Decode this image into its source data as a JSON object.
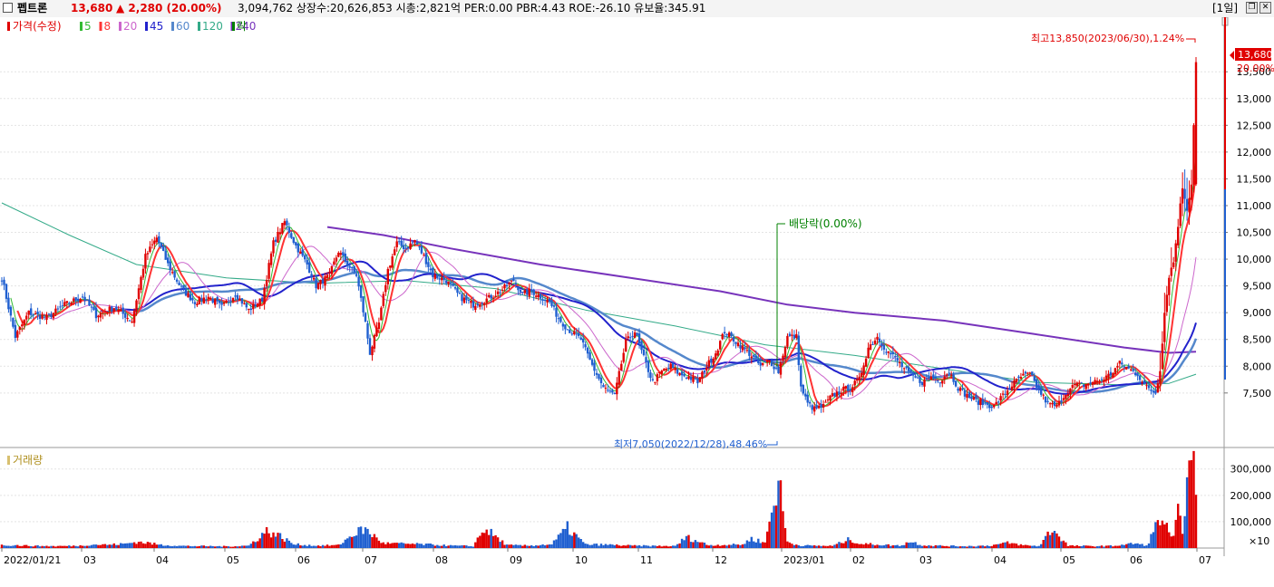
{
  "header": {
    "stock_name": "펩트론",
    "price": "13,680",
    "change": "▲ 2,280 (20.00%)",
    "stats": "3,094,762  상장수:20,626,853 시총:2,821억  PER:0.00  PBR:4.43  ROE:-26.10  유보율:345.91",
    "period": "[1일]"
  },
  "legend": {
    "price_label": "가격(수정)",
    "ma_periods": [
      "5",
      "8",
      "20",
      "45",
      "60",
      "120",
      "240"
    ],
    "ma_colors": [
      "#33bb33",
      "#ff3333",
      "#cc66cc",
      "#2222cc",
      "#5588cc",
      "#33aa88",
      "#7733bb"
    ],
    "drop_label": "락",
    "volume_label": "거래량"
  },
  "annotations": {
    "high": "최고13,850(2023/06/30),1.24%",
    "low": "최저7,050(2022/12/28),48.46%",
    "dividend": "배당락(0.00%)",
    "current_price_tag": "13,680",
    "current_pct_tag": "20.00%",
    "volume_unit": "×10"
  },
  "colors": {
    "up": "#e00000",
    "down": "#1f5fd0",
    "dividend": "#008000"
  },
  "chart_data": {
    "type": "candlestick",
    "price_axis": {
      "ticks": [
        7500,
        8000,
        8500,
        9000,
        9500,
        10000,
        10500,
        11000,
        11500,
        12000,
        12500,
        13000,
        13500
      ],
      "range": [
        6600,
        14350
      ]
    },
    "volume_axis": {
      "ticks": [
        100000,
        200000,
        300000
      ],
      "range": [
        0,
        330000
      ]
    },
    "x_labels": [
      "2022/01/21",
      "03",
      "04",
      "05",
      "06",
      "07",
      "08",
      "09",
      "10",
      "11",
      "12",
      "2023/01",
      "02",
      "03",
      "04",
      "05",
      "06",
      "07"
    ],
    "price_path": [
      [
        0,
        9650
      ],
      [
        6,
        8550
      ],
      [
        12,
        9000
      ],
      [
        20,
        8900
      ],
      [
        28,
        9150
      ],
      [
        36,
        9300
      ],
      [
        42,
        8950
      ],
      [
        50,
        9100
      ],
      [
        58,
        8850
      ],
      [
        64,
        10050
      ],
      [
        69,
        10400
      ],
      [
        74,
        9900
      ],
      [
        80,
        9450
      ],
      [
        86,
        9200
      ],
      [
        92,
        9300
      ],
      [
        98,
        9100
      ],
      [
        104,
        9350
      ],
      [
        110,
        9050
      ],
      [
        116,
        9250
      ],
      [
        121,
        10300
      ],
      [
        126,
        10700
      ],
      [
        131,
        10250
      ],
      [
        136,
        9900
      ],
      [
        140,
        9500
      ],
      [
        146,
        9700
      ],
      [
        150,
        10150
      ],
      [
        154,
        9900
      ],
      [
        158,
        9700
      ],
      [
        162,
        8800
      ],
      [
        164,
        8250
      ],
      [
        168,
        8800
      ],
      [
        172,
        9800
      ],
      [
        176,
        10300
      ],
      [
        180,
        10200
      ],
      [
        184,
        10350
      ],
      [
        188,
        10050
      ],
      [
        192,
        9700
      ],
      [
        198,
        9600
      ],
      [
        204,
        9300
      ],
      [
        210,
        9150
      ],
      [
        216,
        9250
      ],
      [
        222,
        9400
      ],
      [
        228,
        9600
      ],
      [
        232,
        9350
      ],
      [
        236,
        9400
      ],
      [
        240,
        9300
      ],
      [
        244,
        9200
      ],
      [
        248,
        8900
      ],
      [
        252,
        8700
      ],
      [
        258,
        8500
      ],
      [
        262,
        8100
      ],
      [
        268,
        7600
      ],
      [
        273,
        7450
      ],
      [
        278,
        8450
      ],
      [
        282,
        8650
      ],
      [
        286,
        8150
      ],
      [
        290,
        7700
      ],
      [
        294,
        7900
      ],
      [
        298,
        8000
      ],
      [
        302,
        7850
      ],
      [
        306,
        7800
      ],
      [
        310,
        7700
      ],
      [
        314,
        8000
      ],
      [
        318,
        8250
      ],
      [
        322,
        8650
      ],
      [
        326,
        8500
      ],
      [
        330,
        8350
      ],
      [
        334,
        8200
      ],
      [
        338,
        8000
      ],
      [
        342,
        8100
      ],
      [
        346,
        7900
      ],
      [
        350,
        8550
      ],
      [
        354,
        8550
      ],
      [
        356,
        7600
      ],
      [
        359,
        7300
      ],
      [
        362,
        7200
      ],
      [
        366,
        7250
      ],
      [
        370,
        7450
      ],
      [
        374,
        7550
      ],
      [
        378,
        7600
      ],
      [
        382,
        7750
      ],
      [
        386,
        8350
      ],
      [
        390,
        8550
      ],
      [
        394,
        8300
      ],
      [
        398,
        8150
      ],
      [
        402,
        7950
      ],
      [
        406,
        7800
      ],
      [
        410,
        7700
      ],
      [
        414,
        7800
      ],
      [
        418,
        7750
      ],
      [
        422,
        7900
      ],
      [
        426,
        7600
      ],
      [
        430,
        7450
      ],
      [
        434,
        7350
      ],
      [
        438,
        7300
      ],
      [
        442,
        7250
      ],
      [
        446,
        7450
      ],
      [
        450,
        7650
      ],
      [
        454,
        7800
      ],
      [
        458,
        7850
      ],
      [
        462,
        7550
      ],
      [
        466,
        7300
      ],
      [
        470,
        7250
      ],
      [
        474,
        7500
      ],
      [
        478,
        7650
      ],
      [
        482,
        7650
      ],
      [
        486,
        7700
      ],
      [
        490,
        7750
      ],
      [
        494,
        7850
      ],
      [
        498,
        8050
      ],
      [
        502,
        7950
      ],
      [
        506,
        7850
      ],
      [
        510,
        7600
      ],
      [
        514,
        7500
      ],
      [
        516,
        7950
      ],
      [
        518,
        9000
      ],
      [
        520,
        9700
      ],
      [
        522,
        9950
      ],
      [
        524,
        10650
      ],
      [
        526,
        11350
      ],
      [
        528,
        10950
      ],
      [
        530,
        11400
      ],
      [
        532,
        13680
      ]
    ],
    "ma240_path": [
      [
        145,
        10600
      ],
      [
        170,
        10450
      ],
      [
        200,
        10200
      ],
      [
        240,
        9900
      ],
      [
        280,
        9650
      ],
      [
        320,
        9400
      ],
      [
        350,
        9150
      ],
      [
        380,
        9000
      ],
      [
        420,
        8850
      ],
      [
        460,
        8600
      ],
      [
        500,
        8350
      ],
      [
        520,
        8250
      ],
      [
        532,
        8270
      ]
    ],
    "ma120_path": [
      [
        0,
        11050
      ],
      [
        30,
        10450
      ],
      [
        60,
        9900
      ],
      [
        100,
        9650
      ],
      [
        140,
        9550
      ],
      [
        180,
        9600
      ],
      [
        220,
        9450
      ],
      [
        260,
        9050
      ],
      [
        300,
        8750
      ],
      [
        340,
        8400
      ],
      [
        380,
        8200
      ],
      [
        420,
        7950
      ],
      [
        460,
        7700
      ],
      [
        500,
        7650
      ],
      [
        520,
        7680
      ],
      [
        532,
        7850
      ]
    ],
    "volumes": [
      [
        5,
        12000
      ],
      [
        15,
        9000
      ],
      [
        25,
        8000
      ],
      [
        35,
        10000
      ],
      [
        40,
        15000
      ],
      [
        48,
        14000
      ],
      [
        55,
        18000
      ],
      [
        60,
        26000
      ],
      [
        65,
        22000
      ],
      [
        70,
        14000
      ],
      [
        80,
        9000
      ],
      [
        90,
        8000
      ],
      [
        100,
        7000
      ],
      [
        110,
        10000
      ],
      [
        118,
        72000
      ],
      [
        124,
        50000
      ],
      [
        130,
        16000
      ],
      [
        140,
        10000
      ],
      [
        150,
        12000
      ],
      [
        158,
        68000
      ],
      [
        162,
        78000
      ],
      [
        170,
        20000
      ],
      [
        180,
        18000
      ],
      [
        190,
        15000
      ],
      [
        200,
        10000
      ],
      [
        210,
        8000
      ],
      [
        215,
        83000
      ],
      [
        225,
        12000
      ],
      [
        235,
        10000
      ],
      [
        245,
        16000
      ],
      [
        252,
        85000
      ],
      [
        260,
        15000
      ],
      [
        270,
        14000
      ],
      [
        280,
        10000
      ],
      [
        290,
        9000
      ],
      [
        300,
        8000
      ],
      [
        305,
        46000
      ],
      [
        315,
        12000
      ],
      [
        330,
        15000
      ],
      [
        334,
        40000
      ],
      [
        340,
        22000
      ],
      [
        346,
        289000
      ],
      [
        350,
        25000
      ],
      [
        355,
        12000
      ],
      [
        360,
        10000
      ],
      [
        370,
        9000
      ],
      [
        378,
        38000
      ],
      [
        382,
        18000
      ],
      [
        390,
        15000
      ],
      [
        400,
        10000
      ],
      [
        405,
        28000
      ],
      [
        410,
        12000
      ],
      [
        420,
        9000
      ],
      [
        430,
        8000
      ],
      [
        440,
        10000
      ],
      [
        448,
        22000
      ],
      [
        455,
        12000
      ],
      [
        462,
        8000
      ],
      [
        468,
        82000
      ],
      [
        475,
        10000
      ],
      [
        485,
        8000
      ],
      [
        495,
        9000
      ],
      [
        505,
        20000
      ],
      [
        510,
        10000
      ],
      [
        516,
        125000
      ],
      [
        518,
        110000
      ],
      [
        520,
        55000
      ],
      [
        522,
        40000
      ],
      [
        524,
        142000
      ],
      [
        526,
        88000
      ],
      [
        528,
        300000
      ],
      [
        530,
        310000
      ]
    ]
  }
}
